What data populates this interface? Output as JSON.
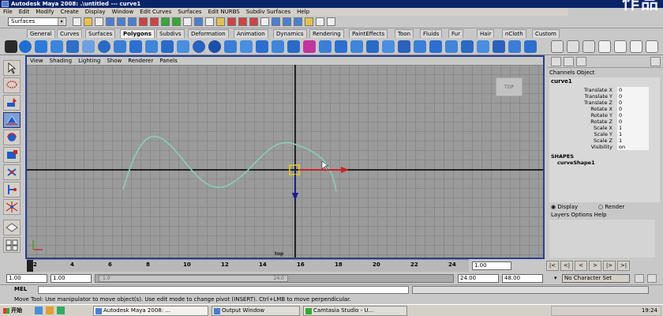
{
  "window": {
    "title": "Autodesk Maya 2008: .\\untitled      ---      curve1"
  },
  "watermark": "作品",
  "menubar": [
    "File",
    "Edit",
    "Modify",
    "Create",
    "Display",
    "Window",
    "Edit Curves",
    "Surfaces",
    "Edit NURBS",
    "Subdiv Surfaces",
    "Help"
  ],
  "status": {
    "menu_set": "Surfaces"
  },
  "shelf_tabs": [
    "General",
    "Curves",
    "Surfaces",
    "Polygons",
    "Subdivs",
    "Deformation",
    "Animation",
    "Dynamics",
    "Rendering",
    "PaintEffects",
    "Toon",
    "Fluids",
    "Fur",
    "Hair",
    "nCloth",
    "Custom"
  ],
  "shelf_active": "Polygons",
  "panel_menu": [
    "View",
    "Shading",
    "Lighting",
    "Show",
    "Renderer",
    "Panels"
  ],
  "viewport": {
    "viewcube_label": "TOP",
    "camera_label": "top"
  },
  "colors": {
    "curve": "#8cc8b8",
    "manip_x": "#cc2222",
    "manip_y": "#1a1a99",
    "panel_border": "#2b3f8f",
    "grid_bg": "#9b9b9b"
  },
  "timeline": {
    "ticks": [
      "2",
      "4",
      "6",
      "8",
      "10",
      "12",
      "14",
      "16",
      "18",
      "20",
      "22",
      "24"
    ],
    "current_frame": "1.00",
    "playback_buttons": [
      "|<",
      "<|",
      "<",
      ">",
      "|>",
      ">|"
    ]
  },
  "range": {
    "start": "1.00",
    "playback_start": "1.00",
    "slider_start": "1.0",
    "slider_end": "24.0",
    "playback_end": "24.00",
    "end": "48.00",
    "character_set": "No Character Set"
  },
  "command_line": {
    "label": "MEL"
  },
  "help_line": "Move Tool: Use manipulator to move object(s). Use edit mode to change pivot (INSERT).  Ctrl+LMB to move perpendicular.",
  "channel_box": {
    "menu": [
      "Channels",
      "Object"
    ],
    "object": "curve1",
    "attributes": [
      {
        "name": "Translate X",
        "value": "0"
      },
      {
        "name": "Translate Y",
        "value": "0"
      },
      {
        "name": "Translate Z",
        "value": "0"
      },
      {
        "name": "Rotate X",
        "value": "0"
      },
      {
        "name": "Rotate Y",
        "value": "0"
      },
      {
        "name": "Rotate Z",
        "value": "0"
      },
      {
        "name": "Scale X",
        "value": "1"
      },
      {
        "name": "Scale Y",
        "value": "1"
      },
      {
        "name": "Scale Z",
        "value": "1"
      },
      {
        "name": "Visibility",
        "value": "on"
      }
    ],
    "shapes_header": "SHAPES",
    "shape_name": "curveShape1"
  },
  "layer_editor": {
    "radio_display": "Display",
    "radio_render": "Render",
    "menu": [
      "Layers",
      "Options",
      "Help"
    ]
  },
  "taskbar": {
    "start": "开始",
    "buttons": [
      "Autodesk Maya 2008: ...",
      "Output Window",
      "Camtasia Studio - U..."
    ],
    "clock": "19:24"
  }
}
